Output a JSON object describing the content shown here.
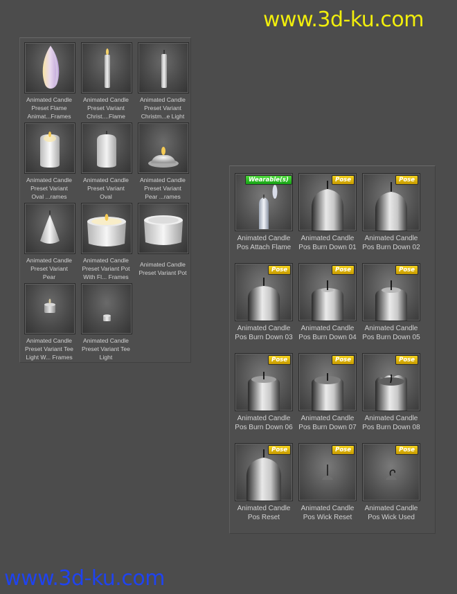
{
  "watermark": {
    "top": "www.3d-ku.com",
    "bottom": "www.3d-ku.com"
  },
  "colors": {
    "watermark_top": "#f1ee0c",
    "watermark_bottom": "#1f43ef",
    "badge_pose": "#e8c013",
    "badge_wearable": "#2ec326",
    "background": "#4c4c4c"
  },
  "left_panel": {
    "items": [
      {
        "icon": "flame-icon",
        "lines": [
          "Animated Candle",
          "Preset Flame",
          "Animat...Frames"
        ]
      },
      {
        "icon": "thin-candle-flame-icon",
        "lines": [
          "Animated Candle",
          "Preset Variant",
          "Christ....Flame"
        ]
      },
      {
        "icon": "thin-candle-icon",
        "lines": [
          "Animated Candle",
          "Preset Variant",
          "Christm...e Light"
        ]
      },
      {
        "icon": "oval-candle-flame-icon",
        "lines": [
          "Animated Candle",
          "Preset Variant",
          "Oval ...rames"
        ]
      },
      {
        "icon": "oval-candle-icon",
        "lines": [
          "Animated Candle",
          "Preset Variant",
          "Oval"
        ]
      },
      {
        "icon": "pear-candle-flame-icon",
        "lines": [
          "Animated Candle",
          "Preset Variant",
          "Pear ...rames"
        ]
      },
      {
        "icon": "pear-candle-icon",
        "lines": [
          "Animated Candle",
          "Preset Variant",
          "Pear"
        ]
      },
      {
        "icon": "pot-candle-flame-icon",
        "lines": [
          "Animated Candle",
          "Preset Variant Pot",
          "With Fl... Frames"
        ]
      },
      {
        "icon": "pot-candle-icon",
        "lines": [
          "Animated Candle",
          "Preset Variant Pot"
        ]
      },
      {
        "icon": "tealight-flame-icon",
        "lines": [
          "Animated Candle",
          "Preset Variant Tee",
          "Light W... Frames"
        ]
      },
      {
        "icon": "tealight-icon",
        "lines": [
          "Animated Candle",
          "Preset Variant Tee",
          "Light"
        ]
      }
    ]
  },
  "right_panel": {
    "items": [
      {
        "badge": "Wearable(s)",
        "icon": "attach-flame-icon",
        "lines": [
          "Animated Candle",
          "Pos Attach Flame"
        ]
      },
      {
        "badge": "Pose",
        "icon": "burn-down-01-icon",
        "lines": [
          "Animated Candle",
          "Pos Burn Down 01"
        ]
      },
      {
        "badge": "Pose",
        "icon": "burn-down-02-icon",
        "lines": [
          "Animated Candle",
          "Pos Burn Down 02"
        ]
      },
      {
        "badge": "Pose",
        "icon": "burn-down-03-icon",
        "lines": [
          "Animated Candle",
          "Pos Burn Down 03"
        ]
      },
      {
        "badge": "Pose",
        "icon": "burn-down-04-icon",
        "lines": [
          "Animated Candle",
          "Pos Burn Down 04"
        ]
      },
      {
        "badge": "Pose",
        "icon": "burn-down-05-icon",
        "lines": [
          "Animated Candle",
          "Pos Burn Down 05"
        ]
      },
      {
        "badge": "Pose",
        "icon": "burn-down-06-icon",
        "lines": [
          "Animated Candle",
          "Pos Burn Down 06"
        ]
      },
      {
        "badge": "Pose",
        "icon": "burn-down-07-icon",
        "lines": [
          "Animated Candle",
          "Pos Burn Down 07"
        ]
      },
      {
        "badge": "Pose",
        "icon": "burn-down-08-icon",
        "lines": [
          "Animated Candle",
          "Pos Burn Down 08"
        ]
      },
      {
        "badge": "Pose",
        "icon": "reset-icon",
        "lines": [
          "Animated Candle",
          "Pos Reset"
        ]
      },
      {
        "badge": "Pose",
        "icon": "wick-reset-icon",
        "lines": [
          "Animated Candle",
          "Pos Wick Reset"
        ]
      },
      {
        "badge": "Pose",
        "icon": "wick-used-icon",
        "lines": [
          "Animated Candle",
          "Pos Wick Used"
        ]
      }
    ]
  }
}
